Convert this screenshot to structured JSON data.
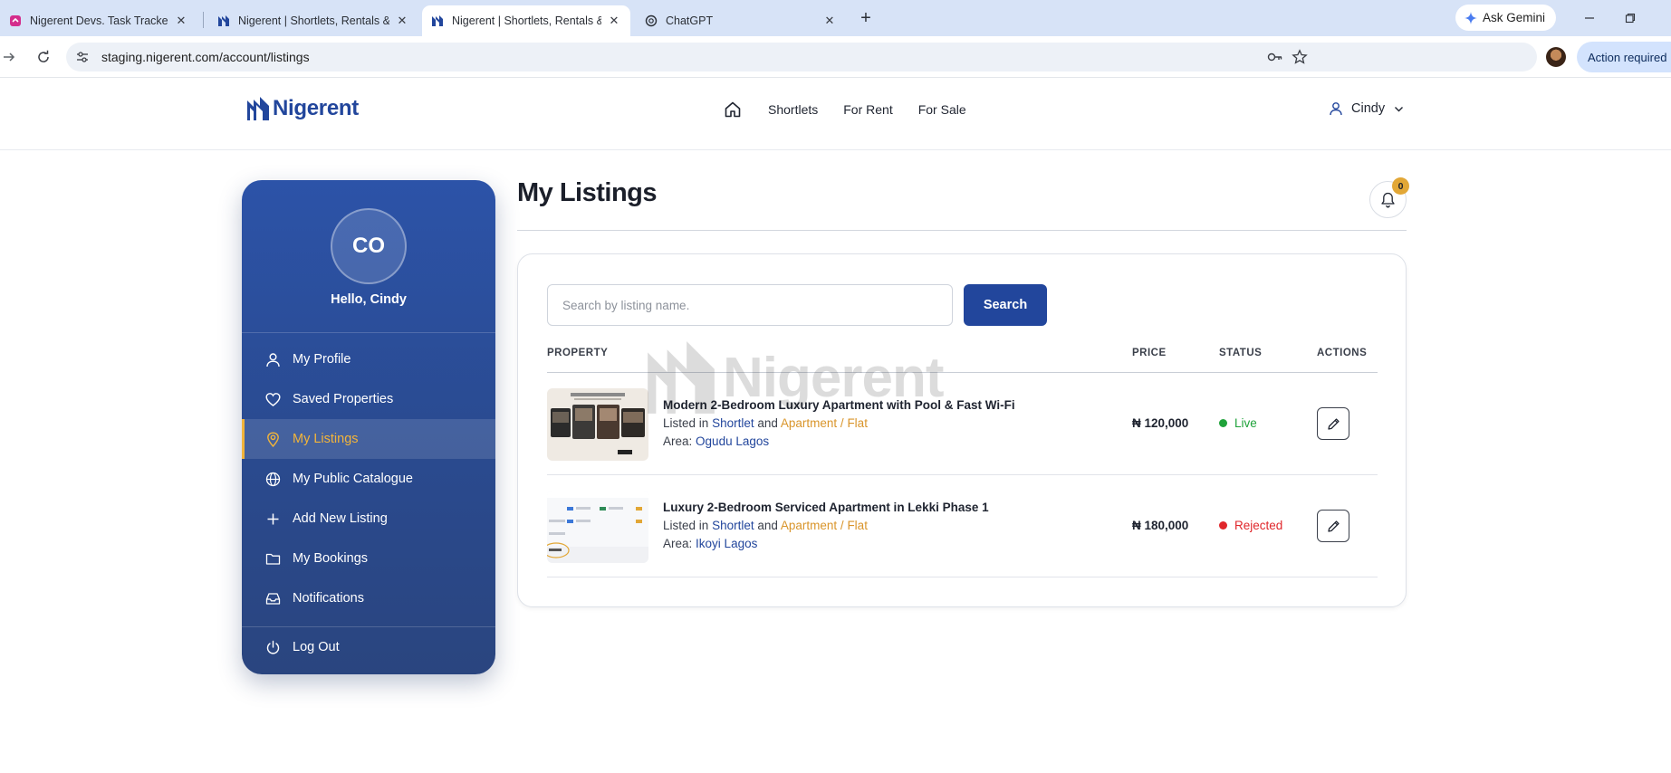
{
  "browser": {
    "tabs": [
      {
        "label": "Nigerent Devs. Task Tracker : *M",
        "favicon": "clickup-icon"
      },
      {
        "label": "Nigerent | Shortlets, Rentals & F",
        "favicon": "nigerent-icon"
      },
      {
        "label": "Nigerent | Shortlets, Rentals & F",
        "favicon": "nigerent-icon",
        "active": true
      },
      {
        "label": "ChatGPT",
        "favicon": "chatgpt-icon"
      }
    ],
    "gemini_label": "Ask Gemini",
    "url": "staging.nigerent.com/account/listings",
    "action_required": "Action required"
  },
  "header": {
    "logo_text": "Nigerent",
    "nav": [
      "Shortlets",
      "For Rent",
      "For Sale"
    ],
    "user_name": "Cindy"
  },
  "sidebar": {
    "initials": "CO",
    "greeting": "Hello, Cindy",
    "items": [
      {
        "label": "My Profile",
        "icon": "user-icon"
      },
      {
        "label": "Saved Properties",
        "icon": "heart-icon"
      },
      {
        "label": "My Listings",
        "icon": "location-pin-icon",
        "active": true
      },
      {
        "label": "My Public Catalogue",
        "icon": "globe-icon"
      },
      {
        "label": "Add New Listing",
        "icon": "plus-icon"
      },
      {
        "label": "My Bookings",
        "icon": "folder-icon"
      },
      {
        "label": "Notifications",
        "icon": "inbox-icon"
      }
    ],
    "logout_label": "Log Out"
  },
  "main": {
    "title": "My Listings",
    "notification_count": "0",
    "search": {
      "placeholder": "Search by listing name.",
      "button_label": "Search"
    },
    "columns": [
      "PROPERTY",
      "PRICE",
      "STATUS",
      "ACTIONS"
    ],
    "watermark_text": "Nigerent",
    "listings": [
      {
        "title": "Modern 2-Bedroom Luxury Apartment with Pool & Fast Wi-Fi",
        "listed_prefix": "Listed in",
        "category": "Shortlet",
        "joiner": "and",
        "type": "Apartment / Flat",
        "area_prefix": "Area:",
        "area": "Ogudu Lagos",
        "price": "₦ 120,000",
        "status": "Live",
        "status_color": "#1fa23a"
      },
      {
        "title": "Luxury 2-Bedroom Serviced Apartment in Lekki Phase 1",
        "listed_prefix": "Listed in",
        "category": "Shortlet",
        "joiner": "and",
        "type": "Apartment / Flat",
        "area_prefix": "Area:",
        "area": "Ikoyi Lagos",
        "price": "₦ 180,000",
        "status": "Rejected",
        "status_color": "#e0262b"
      }
    ]
  },
  "colors": {
    "brand": "#22469c",
    "accent": "#f2b43a"
  }
}
